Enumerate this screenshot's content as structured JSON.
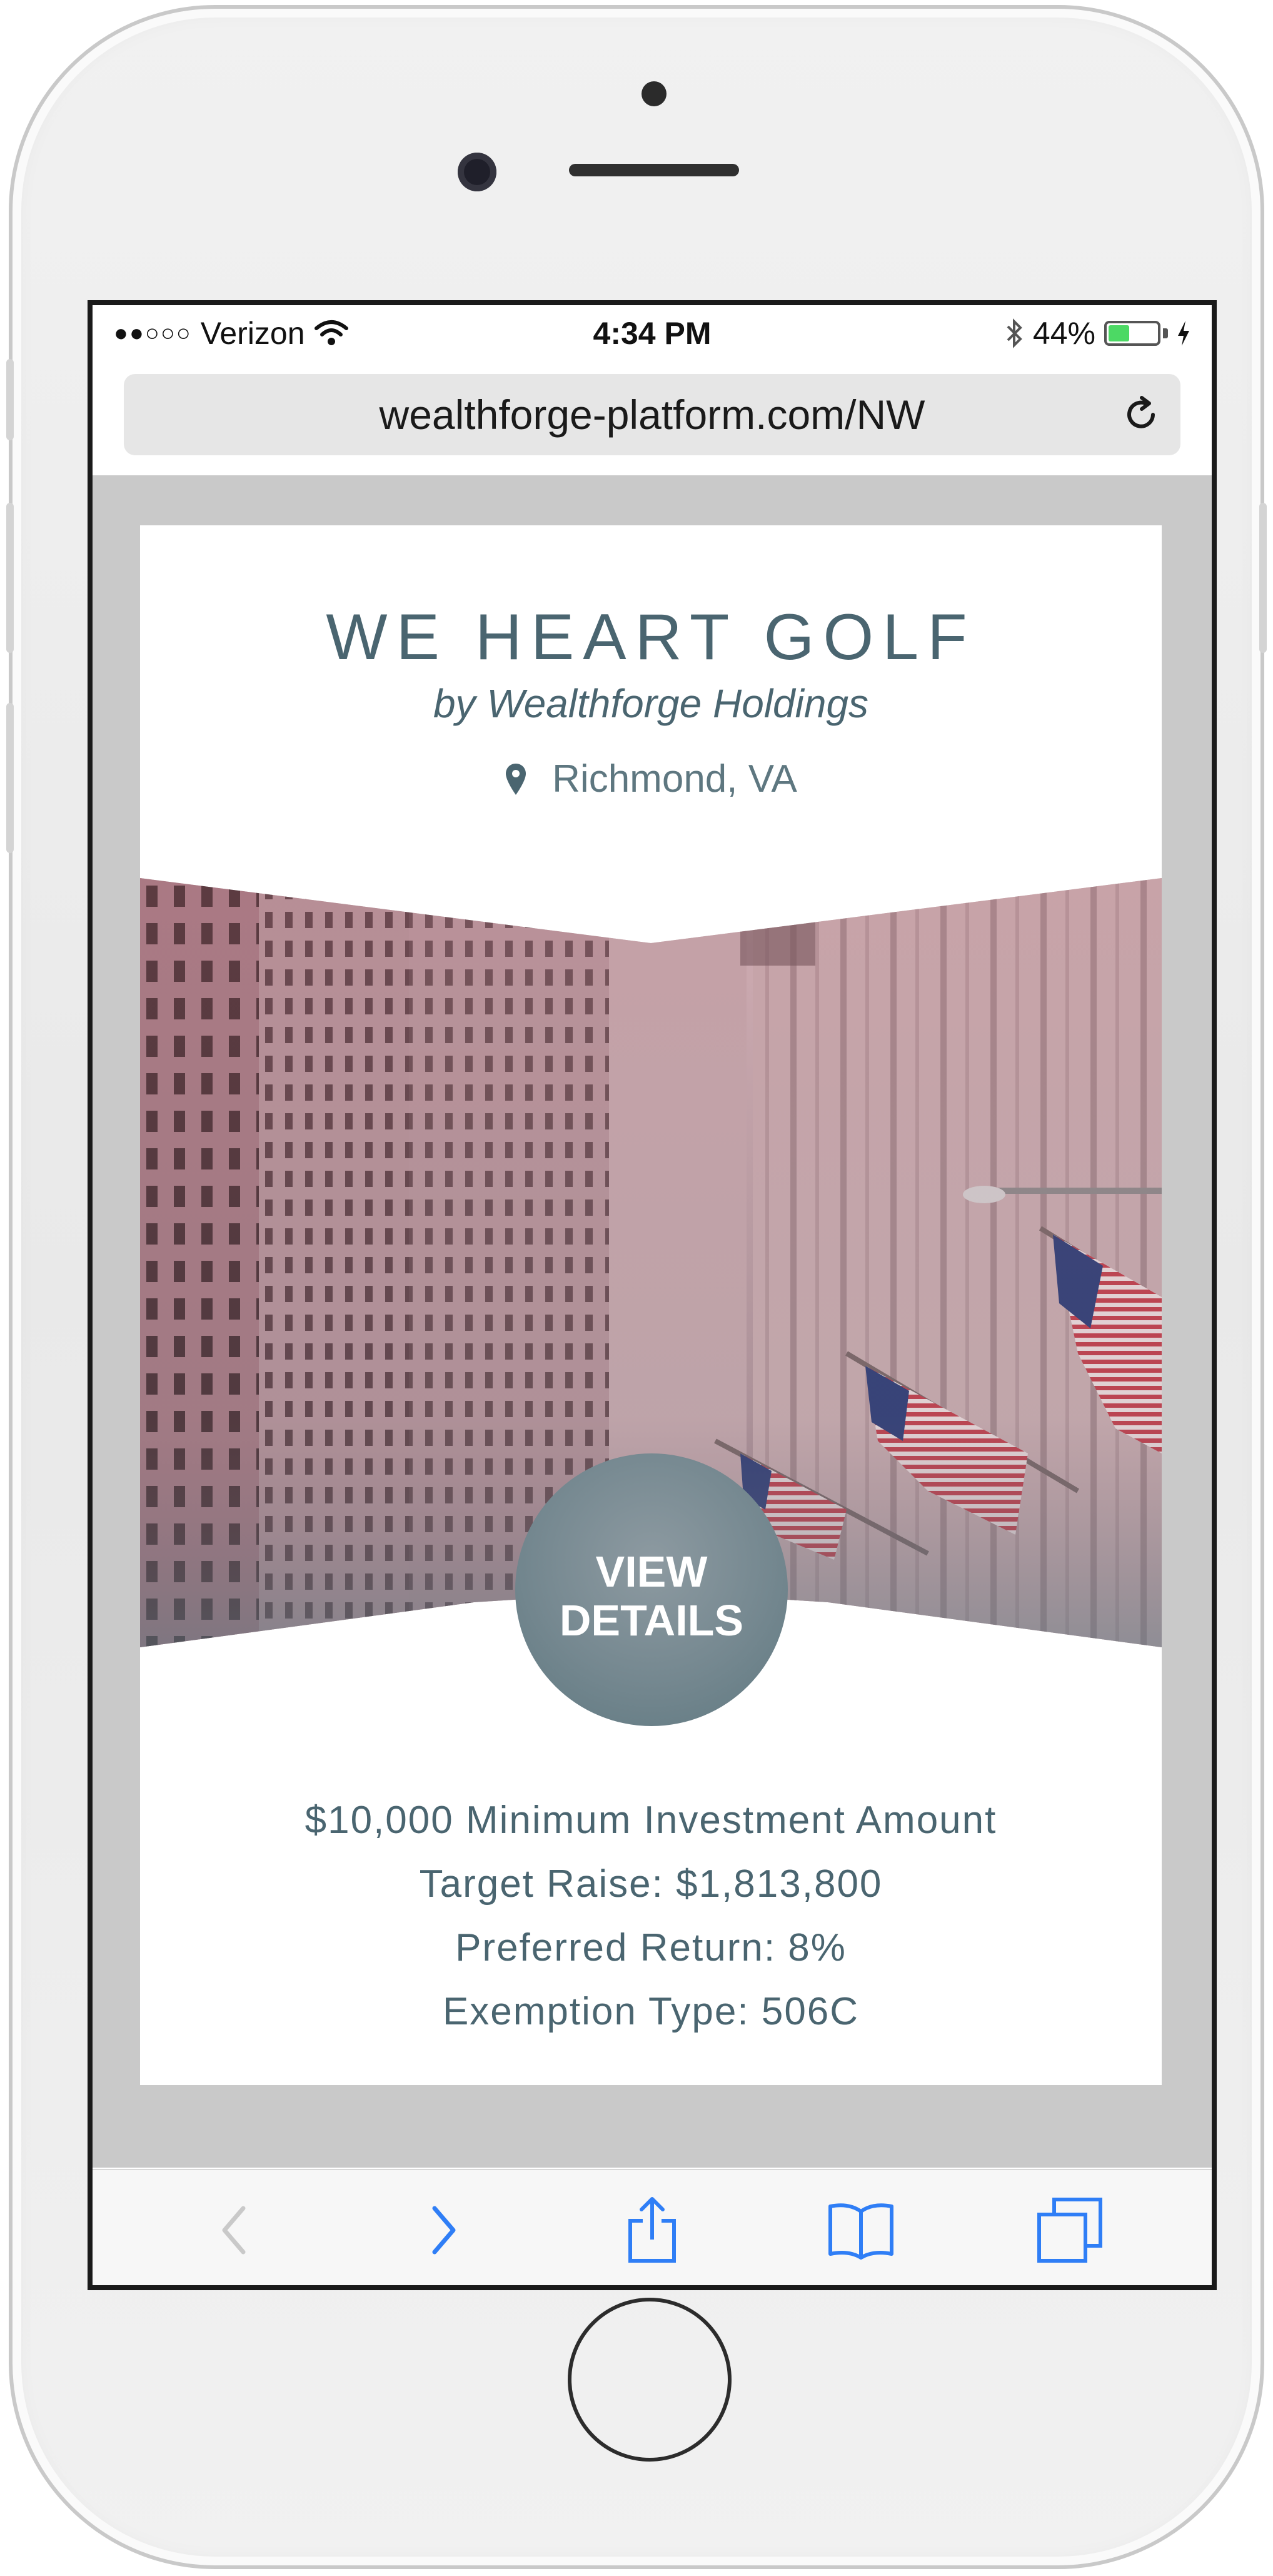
{
  "status_bar": {
    "carrier": "Verizon",
    "signal_text": "●●○○○",
    "time": "4:34 PM",
    "battery_percent": "44%",
    "battery_level": 0.44
  },
  "browser": {
    "url": "wealthforge-platform.com/NW"
  },
  "offering": {
    "title": "WE HEART GOLF",
    "subtitle": "by Wealthforge Holdings",
    "location": "Richmond, VA",
    "cta_line1": "VIEW",
    "cta_line2": "DETAILS",
    "details": [
      "$10,000 Minimum Investment Amount",
      "Target Raise: $1,813,800",
      "Preferred Return: 8%",
      "Exemption Type: 506C"
    ]
  },
  "colors": {
    "accent": "#4a6570",
    "ios_blue": "#2f7ef6",
    "page_bg": "#c9c9c9"
  }
}
